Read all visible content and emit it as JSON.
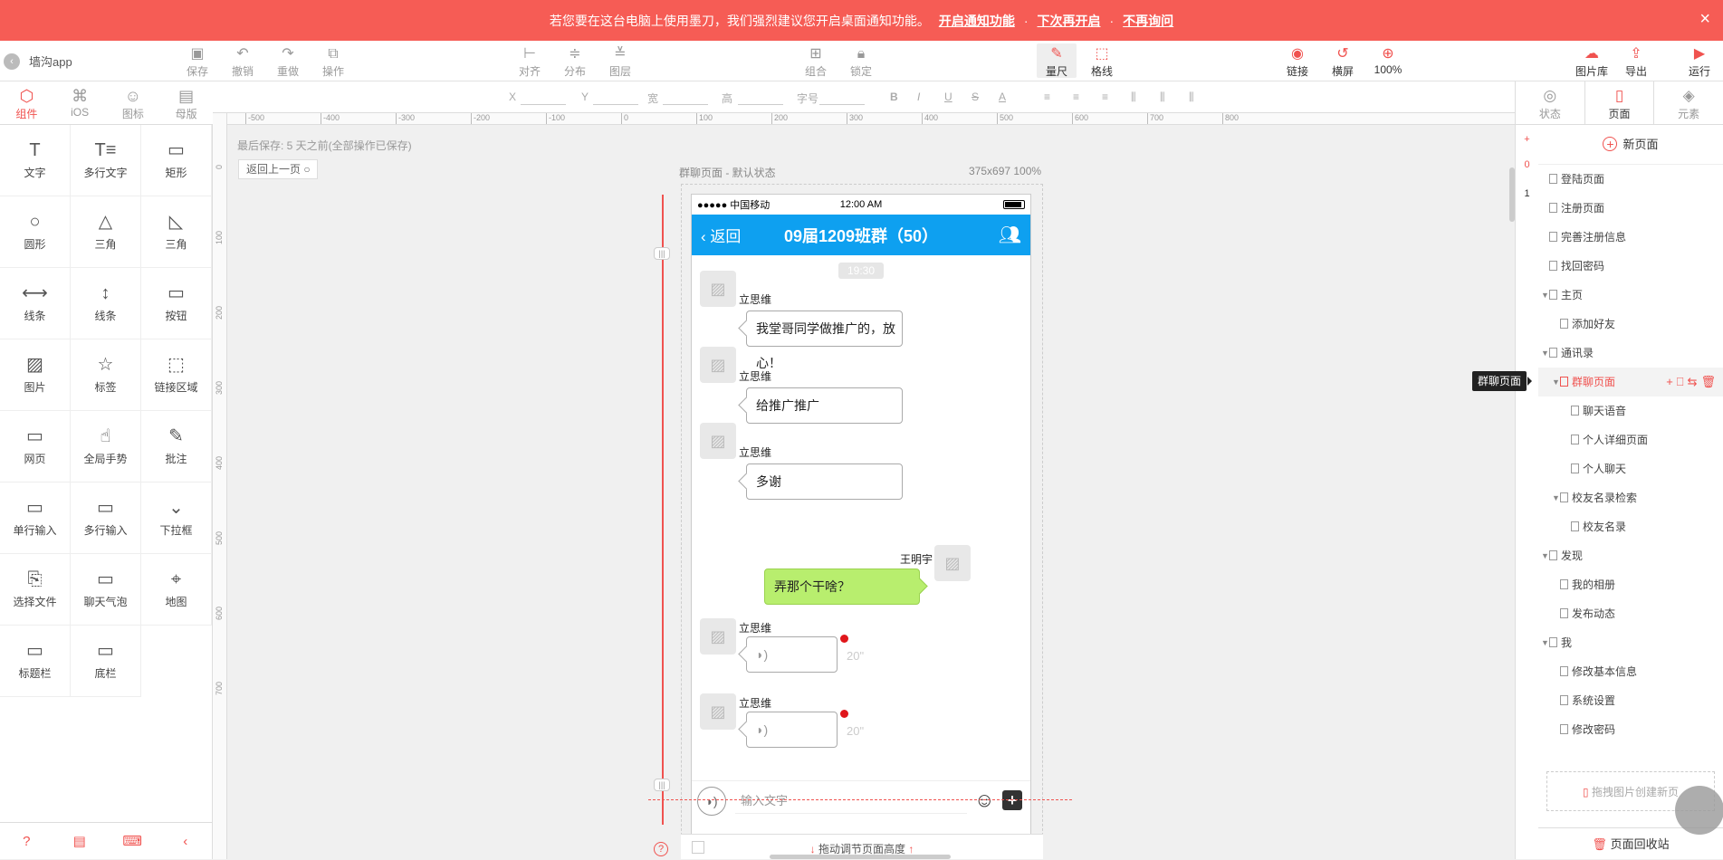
{
  "notice": {
    "text": "若您要在这台电脑上使用墨刀，我们强烈建议您开启桌面通知功能。",
    "link_enable": "开启通知功能",
    "sep1": "·",
    "link_later": "下次再开启",
    "sep2": "·",
    "link_never": "不再询问",
    "close": "×"
  },
  "project": {
    "back": "‹",
    "name": "墙沟app"
  },
  "toolbar": {
    "save": "保存",
    "undo": "撤销",
    "redo": "重做",
    "operate": "操作",
    "align": "对齐",
    "distribute": "分布",
    "layer": "图层",
    "group": "组合",
    "lock": "锁定",
    "ruler": "量尺",
    "grid": "格线",
    "link": "链接",
    "rotate": "横屏",
    "zoom": "100%",
    "gallery": "图片库",
    "export": "导出",
    "run": "运行"
  },
  "lefttabs": [
    "组件",
    "iOS",
    "图标",
    "母版"
  ],
  "widgets": [
    {
      "label": "文字",
      "icon": "T"
    },
    {
      "label": "多行文字",
      "icon": "T≡"
    },
    {
      "label": "矩形",
      "icon": "▭"
    },
    {
      "label": "圆形",
      "icon": "○"
    },
    {
      "label": "三角",
      "icon": "△"
    },
    {
      "label": "三角",
      "icon": "◺"
    },
    {
      "label": "线条",
      "icon": "⟷"
    },
    {
      "label": "线条",
      "icon": "↕"
    },
    {
      "label": "按钮",
      "icon": "▭"
    },
    {
      "label": "图片",
      "icon": "▨"
    },
    {
      "label": "标签",
      "icon": "☆"
    },
    {
      "label": "链接区域",
      "icon": "⬚"
    },
    {
      "label": "网页",
      "icon": "▭"
    },
    {
      "label": "全局手势",
      "icon": "☝"
    },
    {
      "label": "批注",
      "icon": "✎"
    },
    {
      "label": "单行输入",
      "icon": "▭"
    },
    {
      "label": "多行输入",
      "icon": "▭"
    },
    {
      "label": "下拉框",
      "icon": "⌄"
    },
    {
      "label": "选择文件",
      "icon": "⎘"
    },
    {
      "label": "聊天气泡",
      "icon": "▭"
    },
    {
      "label": "地图",
      "icon": "⌖"
    },
    {
      "label": "标题栏",
      "icon": "▭"
    },
    {
      "label": "底栏",
      "icon": "▭"
    }
  ],
  "props": {
    "x": "X",
    "y": "Y",
    "w": "宽",
    "h": "高",
    "size": "字号",
    "styles": [
      "B",
      "I",
      "U",
      "S",
      "A"
    ]
  },
  "ruler_h": [
    "-500",
    "-400",
    "-300",
    "-200",
    "-100",
    "0",
    "100",
    "200",
    "300",
    "400",
    "500",
    "600",
    "700",
    "800"
  ],
  "ruler_v": [
    "0",
    "100",
    "200",
    "300",
    "400",
    "500",
    "600",
    "700"
  ],
  "canvas": {
    "last_save": "最后保存: 5 天之前(全部操作已保存)",
    "back_prev": "返回上一页 ○",
    "page_label": "群聊页面 - 默认状态",
    "page_size": "375x697 100%",
    "drag_hint": "拖动调节页面高度"
  },
  "phone": {
    "carrier": "●●●●● 中国移动",
    "time": "12:00 AM",
    "back": "返回",
    "title": "09届1209班群（50）",
    "timestamp": "19:30",
    "messages": [
      {
        "sender": "立思维",
        "text": "我堂哥同学做推广的，放心！"
      },
      {
        "sender": "立思维",
        "text": "给推广推广"
      },
      {
        "sender": "立思维",
        "text": "多谢"
      },
      {
        "sender": "王明宇",
        "text": "弄那个干啥？"
      },
      {
        "sender": "立思维",
        "voice": "20\""
      },
      {
        "sender": "立思维",
        "voice": "20\""
      }
    ],
    "input_placeholder": "输入文字"
  },
  "layer_nums": [
    "0",
    "1"
  ],
  "righttabs": [
    "状态",
    "页面",
    "元素"
  ],
  "pages": {
    "new_page": "新页面",
    "items": [
      {
        "label": "登陆页面",
        "level": 0,
        "caret": false
      },
      {
        "label": "注册页面",
        "level": 0,
        "caret": false
      },
      {
        "label": "完善注册信息",
        "level": 0,
        "caret": false
      },
      {
        "label": "找回密码",
        "level": 0,
        "caret": false
      },
      {
        "label": "主页",
        "level": 0,
        "caret": true
      },
      {
        "label": "添加好友",
        "level": 1,
        "caret": false
      },
      {
        "label": "通讯录",
        "level": 0,
        "caret": true
      },
      {
        "label": "群聊页面",
        "level": 1,
        "caret": true,
        "selected": true
      },
      {
        "label": "聊天语音",
        "level": 2,
        "caret": false
      },
      {
        "label": "个人详细页面",
        "level": 2,
        "caret": false
      },
      {
        "label": "个人聊天",
        "level": 2,
        "caret": false
      },
      {
        "label": "校友名录检索",
        "level": 1,
        "caret": true
      },
      {
        "label": "校友名录",
        "level": 2,
        "caret": false
      },
      {
        "label": "发现",
        "level": 0,
        "caret": true
      },
      {
        "label": "我的相册",
        "level": 1,
        "caret": false
      },
      {
        "label": "发布动态",
        "level": 1,
        "caret": false
      },
      {
        "label": "我",
        "level": 0,
        "caret": true
      },
      {
        "label": "修改基本信息",
        "level": 1,
        "caret": false
      },
      {
        "label": "系统设置",
        "level": 1,
        "caret": false
      },
      {
        "label": "修改密码",
        "level": 1,
        "caret": false
      }
    ],
    "tooltip": "群聊页面",
    "drop_hint": "拖拽图片创建新页",
    "recycle": "页面回收站"
  },
  "colors": {
    "accent": "#f0524f",
    "nav": "#0ea0f0",
    "green_bubble": "#b8ee6e",
    "notice": "#f65c55"
  }
}
